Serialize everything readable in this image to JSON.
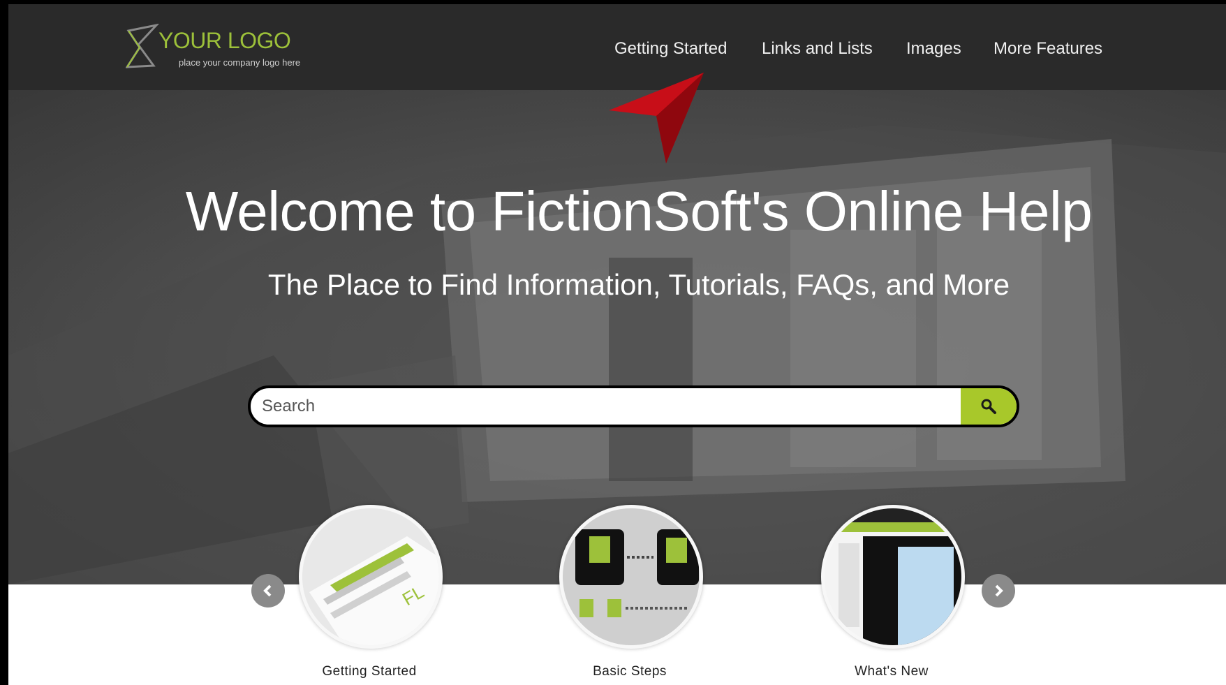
{
  "header": {
    "logo_text": "YOUR LOGO",
    "logo_sub": "place your company logo here",
    "nav": [
      {
        "label": "Getting Started"
      },
      {
        "label": "Links and Lists"
      },
      {
        "label": "Images"
      },
      {
        "label": "More Features"
      }
    ]
  },
  "hero": {
    "title": "Welcome to FictionSoft's Online Help",
    "subtitle": "The Place to Find Information, Tutorials, FAQs, and More"
  },
  "search": {
    "placeholder": "Search"
  },
  "carousel": {
    "tiles": [
      {
        "label": "Getting Started"
      },
      {
        "label": "Basic Steps"
      },
      {
        "label": "What's New"
      }
    ]
  },
  "colors": {
    "accent": "#a8c82a",
    "header_bg": "#2a2a2a",
    "pointer": "#d0101a"
  },
  "icons": [
    "logo-mark-icon",
    "search-icon",
    "chevron-left-icon",
    "chevron-right-icon",
    "pointer-arrow-icon"
  ]
}
